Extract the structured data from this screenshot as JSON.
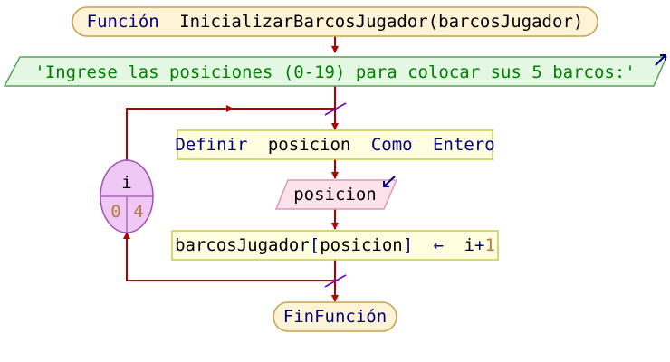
{
  "nodes": {
    "start": {
      "keyword": "Función",
      "name": "InicializarBarcosJugador",
      "open": "(",
      "param": "barcosJugador",
      "close": ")"
    },
    "output": {
      "text": "'Ingrese las posiciones (0-19) para colocar sus 5 barcos:'"
    },
    "define": {
      "kw1": "Definir",
      "var": "posicion",
      "kw2": "Como",
      "type": "Entero"
    },
    "input": {
      "var": "posicion"
    },
    "assign": {
      "target": "barcosJugador",
      "lb": "[",
      "index": "posicion",
      "rb": "]",
      "arrow": "←",
      "var": "i",
      "plus": "+",
      "num": "1"
    },
    "loop": {
      "var": "i",
      "from": "0",
      "to": "4"
    },
    "end": {
      "text": "FinFunción"
    }
  },
  "colors": {
    "line": "#b40000",
    "keyword": "#00007f",
    "identifier": "#000000",
    "string": "#007f00",
    "number": "#b47841",
    "start_fill": "#fff3d7",
    "start_stroke": "#c8a050",
    "output_fill": "#e3f7e3",
    "output_stroke": "#5aa05a",
    "process_fill": "#ffffe0",
    "process_stroke": "#c8c850",
    "input_fill": "#fde2ec",
    "input_stroke": "#d79bb4",
    "loop_fill": "#f0c8f5",
    "loop_stroke": "#a050b4",
    "tick": "#7000c0",
    "io_arrow": "#000080"
  }
}
